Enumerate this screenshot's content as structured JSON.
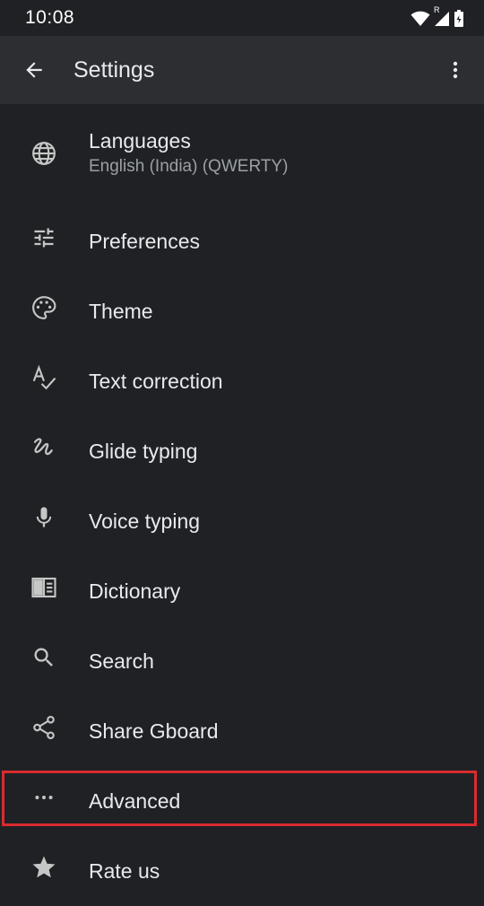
{
  "status_bar": {
    "time": "10:08",
    "signal_badge": "R"
  },
  "app_bar": {
    "title": "Settings"
  },
  "items": [
    {
      "label": "Languages",
      "subtitle": "English (India) (QWERTY)",
      "icon": "globe-icon"
    },
    {
      "label": "Preferences",
      "icon": "tune-icon"
    },
    {
      "label": "Theme",
      "icon": "palette-icon"
    },
    {
      "label": "Text correction",
      "icon": "spellcheck-icon"
    },
    {
      "label": "Glide typing",
      "icon": "gesture-icon"
    },
    {
      "label": "Voice typing",
      "icon": "mic-icon"
    },
    {
      "label": "Dictionary",
      "icon": "book-icon"
    },
    {
      "label": "Search",
      "icon": "search-icon"
    },
    {
      "label": "Share Gboard",
      "icon": "share-icon"
    },
    {
      "label": "Advanced",
      "icon": "more-horiz-icon"
    },
    {
      "label": "Rate us",
      "icon": "star-icon"
    }
  ],
  "colors": {
    "background": "#202124",
    "app_bar": "#2d2e31",
    "text_primary": "#e8eaed",
    "text_secondary": "#9aa0a6",
    "highlight_border": "#d92b30"
  }
}
